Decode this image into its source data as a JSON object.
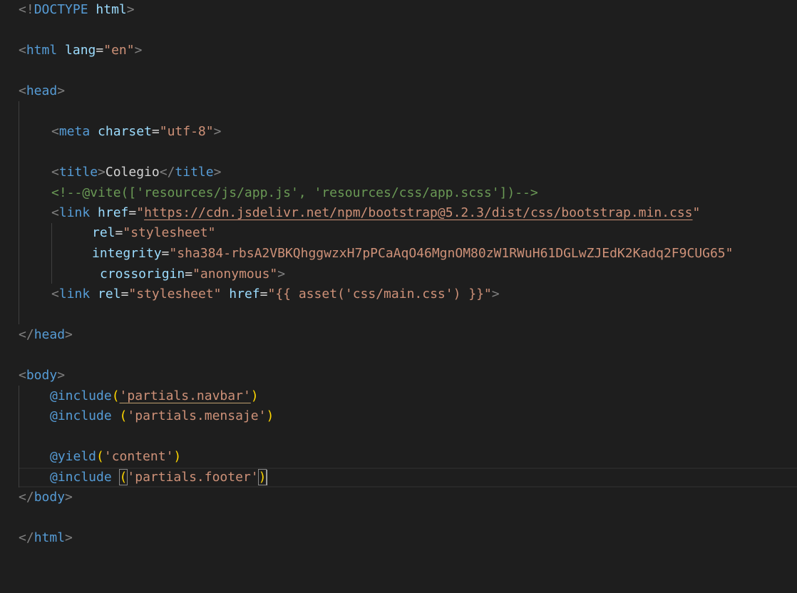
{
  "code": {
    "l1": {
      "lt": "<!",
      "doctype": "DOCTYPE",
      "html": "html",
      "gt": ">"
    },
    "l2": {
      "lt": "<",
      "tag": "html",
      "attr": "lang",
      "eq": "=",
      "val": "\"en\"",
      "gt": ">"
    },
    "l3": {
      "lt": "<",
      "tag": "head",
      "gt": ">"
    },
    "l4": {
      "lt": "<",
      "tag": "meta",
      "attr": "charset",
      "eq": "=",
      "val": "\"utf-8\"",
      "gt": ">"
    },
    "l5": {
      "lt": "<",
      "tag": "title",
      "gt": ">",
      "text": "Colegio",
      "close_lt": "</",
      "close_tag": "title",
      "close_gt": ">"
    },
    "l6": {
      "comment": "<!--@vite(['resources/js/app.js', 'resources/css/app.scss'])-->"
    },
    "l7": {
      "lt": "<",
      "tag": "link",
      "attr": "href",
      "eq": "=",
      "q1": "\"",
      "url": "https://cdn.jsdelivr.net/npm/bootstrap@5.2.3/dist/css/bootstrap.min.css",
      "q2": "\""
    },
    "l8": {
      "attr": "rel",
      "eq": "=",
      "val": "\"stylesheet\""
    },
    "l9": {
      "attr": "integrity",
      "eq": "=",
      "val": "\"sha384-rbsA2VBKQhggwzxH7pPCaAqO46MgnOM80zW1RWuH61DGLwZJEdK2Kadq2F9CUG65\""
    },
    "l10": {
      "attr": "crossorigin",
      "eq": "=",
      "val": "\"anonymous\"",
      "gt": ">"
    },
    "l11": {
      "lt": "<",
      "tag": "link",
      "attr1": "rel",
      "eq1": "=",
      "val1": "\"stylesheet\"",
      "attr2": "href",
      "eq2": "=",
      "val2": "\"{{ asset('css/main.css') }}\"",
      "gt": ">"
    },
    "l12": {
      "lt": "</",
      "tag": "head",
      "gt": ">"
    },
    "l13": {
      "lt": "<",
      "tag": "body",
      "gt": ">"
    },
    "l14": {
      "directive": "@include",
      "open": "(",
      "str": "'partials.navbar'",
      "close": ")"
    },
    "l15": {
      "directive": "@include",
      "space": " ",
      "open": "(",
      "str": "'partials.mensaje'",
      "close": ")"
    },
    "l16": {
      "directive": "@yield",
      "open": "(",
      "str": "'content'",
      "close": ")"
    },
    "l17": {
      "directive": "@include",
      "space": " ",
      "open": "(",
      "str": "'partials.footer'",
      "close": ")"
    },
    "l18": {
      "lt": "</",
      "tag": "body",
      "gt": ">"
    },
    "l19": {
      "lt": "</",
      "tag": "html",
      "gt": ">"
    }
  }
}
